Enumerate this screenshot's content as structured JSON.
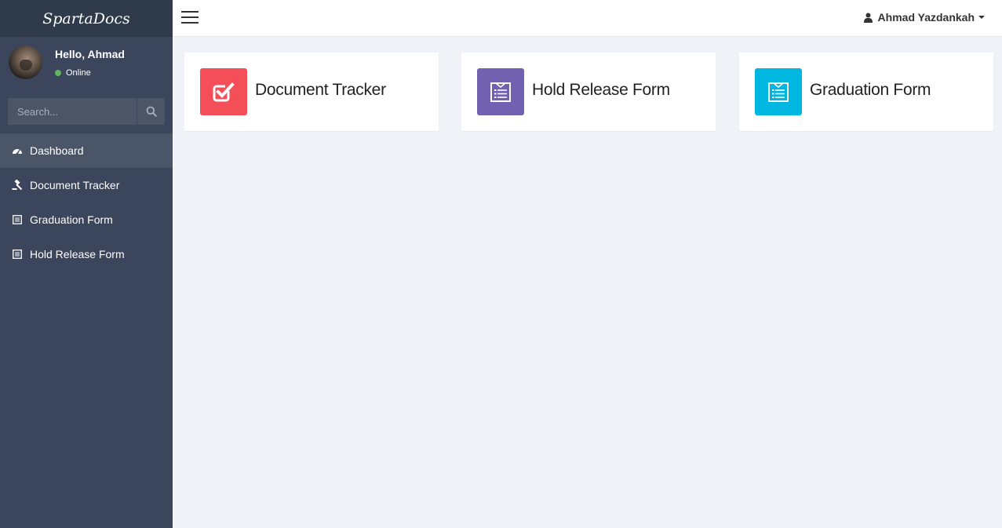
{
  "app": {
    "brand": "SpartaDocs"
  },
  "user_panel": {
    "greeting": "Hello, Ahmad",
    "status": "Online"
  },
  "search": {
    "placeholder": "Search..."
  },
  "sidebar": {
    "items": [
      {
        "label": "Dashboard",
        "icon": "dashboard-icon",
        "active": true
      },
      {
        "label": "Document Tracker",
        "icon": "gavel-icon",
        "active": false
      },
      {
        "label": "Graduation Form",
        "icon": "form-icon",
        "active": false
      },
      {
        "label": "Hold Release Form",
        "icon": "form-icon",
        "active": false
      }
    ]
  },
  "header": {
    "user_name": "Ahmad Yazdankah"
  },
  "cards": [
    {
      "title": "Document Tracker",
      "icon": "checkbox-icon",
      "color": "#f44e58"
    },
    {
      "title": "Hold Release Form",
      "icon": "form-icon",
      "color": "#7260b0"
    },
    {
      "title": "Graduation Form",
      "icon": "form-icon",
      "color": "#00b7e2"
    }
  ],
  "colors": {
    "sidebar": "#3b455c",
    "brand_bar": "#2f3a4a",
    "online": "#5cb85c"
  }
}
